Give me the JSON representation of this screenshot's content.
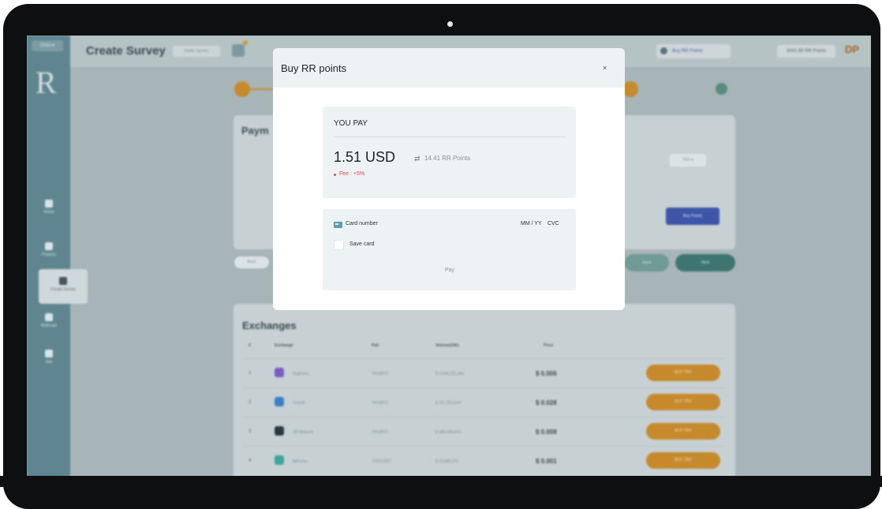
{
  "background_app": {
    "lang": "ENG ▾",
    "page_title": "Create Survey",
    "survey_type": "Public Survey",
    "buy_button": "Buy RR Points",
    "points_balance": "3041.65 RR Points",
    "avatar_initials": "DP",
    "payment_card_title": "Paym",
    "currency_dropdown": "TRX ▾",
    "buy_points_button": "Buy Points",
    "back_button": "Back",
    "save_button": "Save",
    "next_button": "Next",
    "sidebar": [
      {
        "label": "Home"
      },
      {
        "label": "Projects"
      },
      {
        "label": "Create Survey"
      },
      {
        "label": "Referrals"
      },
      {
        "label": "Info"
      }
    ],
    "exchanges": {
      "title": "Exchanges",
      "headers": [
        "#",
        "Exchange",
        "Pair",
        "Volume(24h)",
        "Price"
      ],
      "rows": [
        {
          "num": "1",
          "name": "DigiFinex",
          "pair": "TRX/BTC",
          "volume": "$ 3,048,221,466",
          "price": "$ 0.006",
          "action": "BUY TRX",
          "icon_color": "#7a5cc2"
        },
        {
          "num": "2",
          "name": "Coinall",
          "pair": "TRX/BTC",
          "volume": "$ 161,222,524",
          "price": "$ 0.028",
          "action": "BUY TRX",
          "icon_color": "#3c7fc6"
        },
        {
          "num": "3",
          "name": "ZB.Network",
          "pair": "TRX/BTC",
          "volume": "$ 988,438,933",
          "price": "$ 0.008",
          "action": "BUY TRX",
          "icon_color": "#2c3a3e"
        },
        {
          "num": "4",
          "name": "BitForex",
          "pair": "TRX/USDT",
          "volume": "$ 25,485,074",
          "price": "$ 0.001",
          "action": "BUY TRX",
          "icon_color": "#3aa79a"
        }
      ]
    }
  },
  "modal": {
    "title": "Buy RR points",
    "close_glyph": "×",
    "you_pay_label": "YOU PAY",
    "amount": "1.51 USD",
    "swap_glyph": "⇄",
    "points_equivalent": "14.41 RR Points",
    "fee": "Fee : +5%",
    "card_number_placeholder": "Card number",
    "expiry_placeholder": "MM / YY",
    "cvc_placeholder": "CVC",
    "save_card_label": "Save card",
    "pay_button": "Pay"
  },
  "colors": {
    "accent_orange": "#c68a2d",
    "fee_red": "#e04848",
    "panel_bg": "#edf2f4"
  }
}
